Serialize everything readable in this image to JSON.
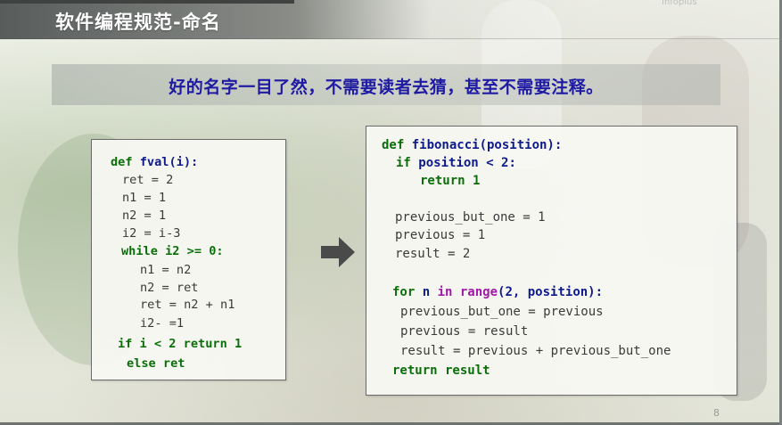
{
  "slide": {
    "title": "软件编程规范-命名",
    "top_right_faint": "Infoplus",
    "subtitle": "好的名字一目了然，不需要读者去猜，甚至不需要注释。",
    "page_number": "8",
    "arrow_color": "#4a4a4a",
    "colors": {
      "subtitle": "#1f1aa3",
      "keyword": "#0b6e0b",
      "function_name": "#0d1a8a",
      "builtin": "#a11aa6"
    }
  },
  "left_code": {
    "l1_def": "def ",
    "l1_name": "fval(i):",
    "l2": "ret = 2",
    "l3": "n1 = 1",
    "l4": "n2 = 1",
    "l5": "i2 = i-3",
    "l6_kw": "while i2 >= 0:",
    "l7": "n1 = n2",
    "l8": "n2 = ret",
    "l9": "ret = n2 + n1",
    "l10": "i2- =1",
    "l11": "if i < 2 return 1",
    "l12": "else ret"
  },
  "right_code": {
    "l1_def": "def ",
    "l1_name": "fibonacci(position):",
    "l2_if": "if ",
    "l2_rest": "position < 2:",
    "l3": "return 1",
    "l4": "previous_but_one = 1",
    "l5": "previous = 1",
    "l6": "result = 2",
    "l7_for": "for ",
    "l7_n": "n ",
    "l7_in": "in ",
    "l7_range": "range",
    "l7_rest": "(2, position):",
    "l8": "previous_but_one = previous",
    "l9": "previous = result",
    "l10": "result = previous + previous_but_one",
    "l11": "return result"
  }
}
